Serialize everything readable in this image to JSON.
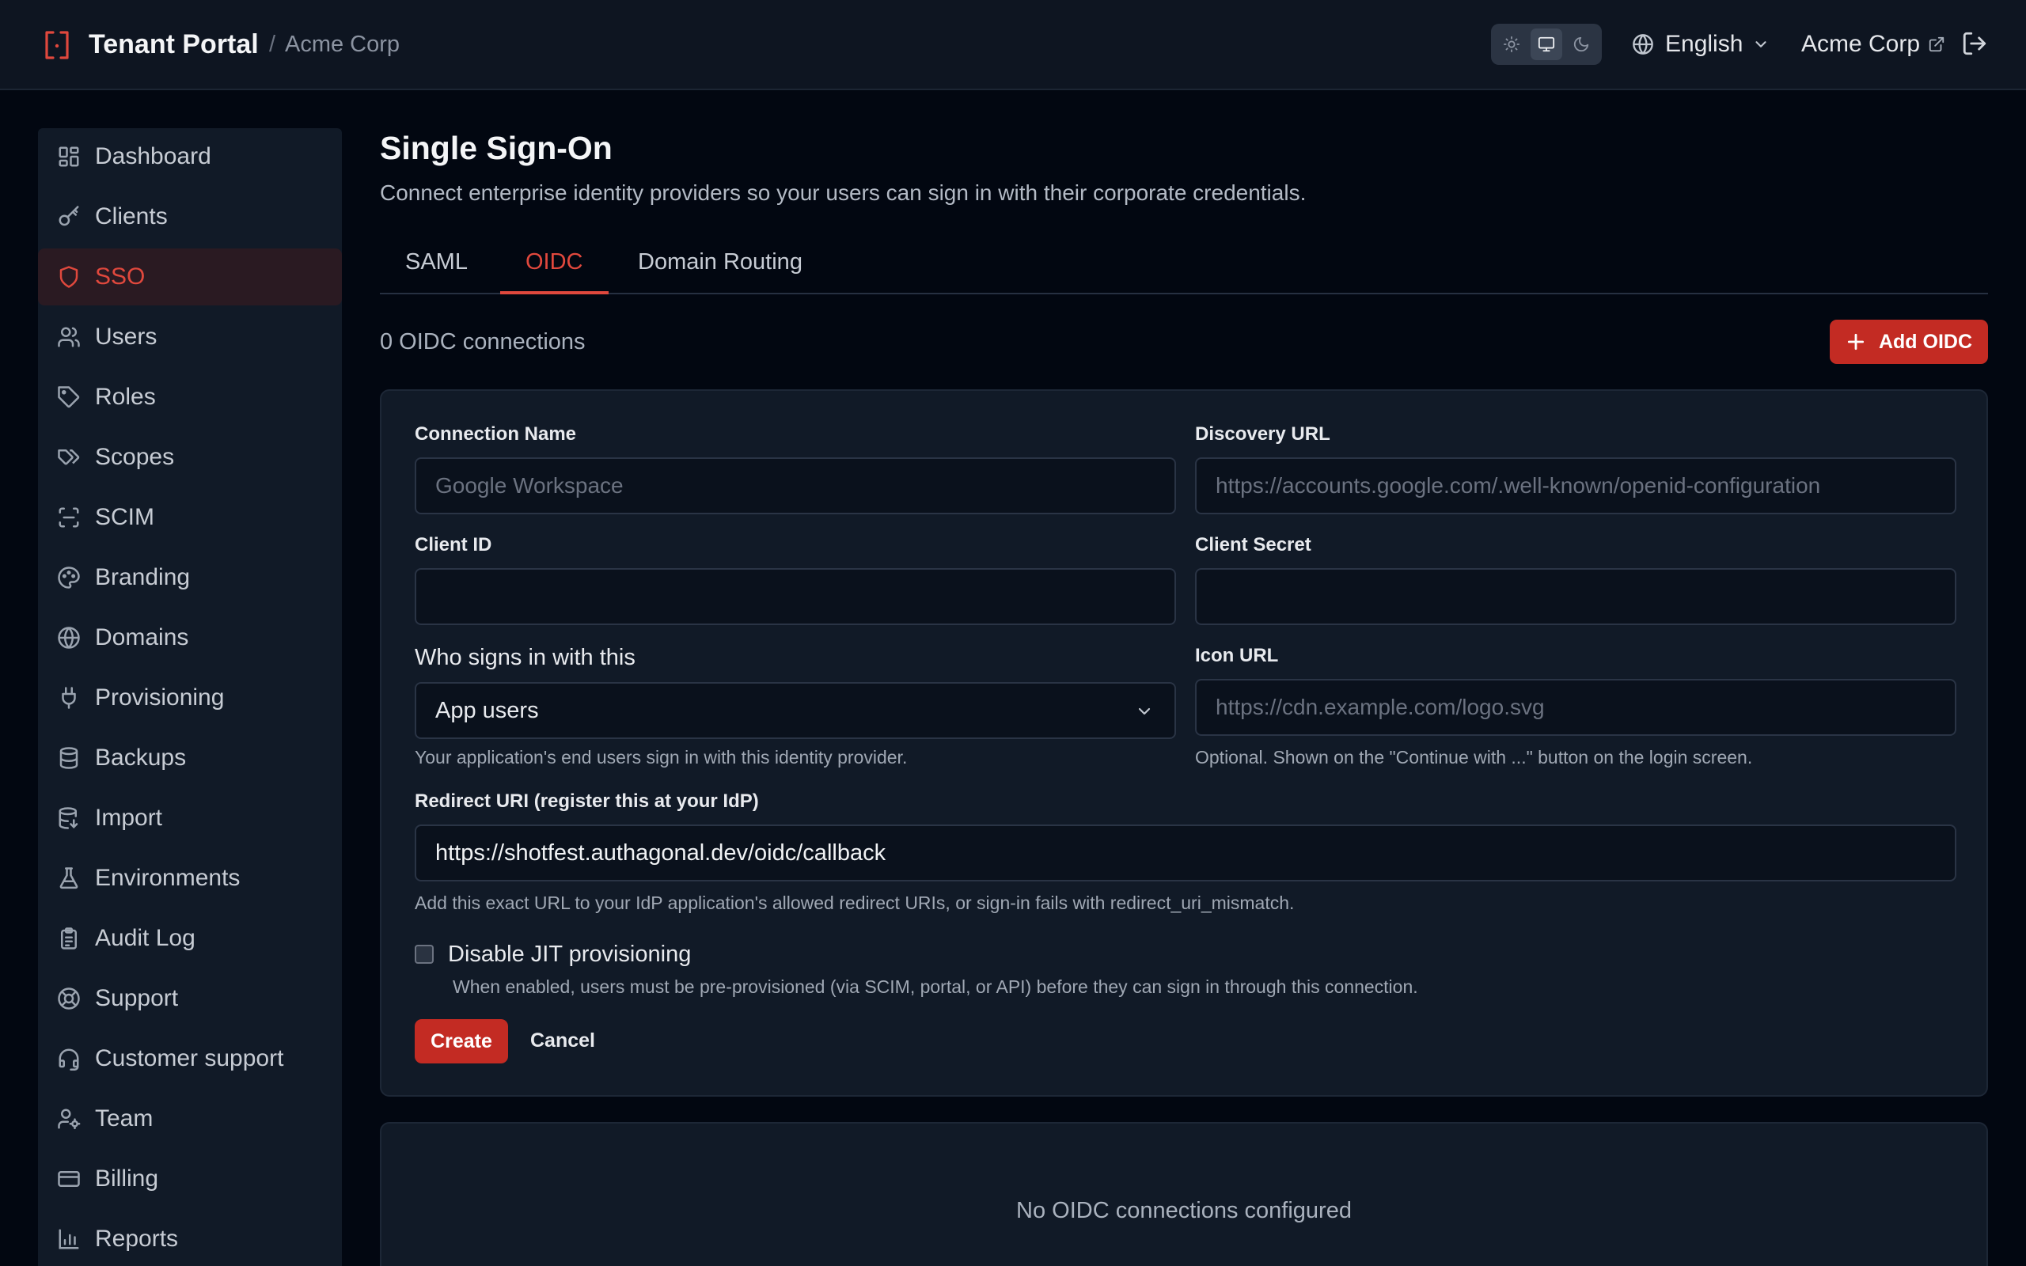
{
  "header": {
    "app_title": "Tenant Portal",
    "separator": "/",
    "tenant_breadcrumb": "Acme Corp",
    "theme_options": [
      "light-icon",
      "system-icon",
      "dark-icon"
    ],
    "theme_selected": "system",
    "language": "English",
    "tenant_link": "Acme Corp"
  },
  "sidebar": {
    "items": [
      {
        "label": "Dashboard",
        "icon": "dashboard-icon"
      },
      {
        "label": "Clients",
        "icon": "key-icon"
      },
      {
        "label": "SSO",
        "icon": "shield-icon",
        "active": true
      },
      {
        "label": "Users",
        "icon": "users-icon"
      },
      {
        "label": "Roles",
        "icon": "tag-icon"
      },
      {
        "label": "Scopes",
        "icon": "tags-icon"
      },
      {
        "label": "SCIM",
        "icon": "scan-icon"
      },
      {
        "label": "Branding",
        "icon": "palette-icon"
      },
      {
        "label": "Domains",
        "icon": "globe-icon"
      },
      {
        "label": "Provisioning",
        "icon": "plug-icon"
      },
      {
        "label": "Backups",
        "icon": "database-icon"
      },
      {
        "label": "Import",
        "icon": "database-import-icon"
      },
      {
        "label": "Environments",
        "icon": "flask-icon"
      },
      {
        "label": "Audit Log",
        "icon": "clipboard-icon"
      },
      {
        "label": "Support",
        "icon": "lifebuoy-icon"
      },
      {
        "label": "Customer support",
        "icon": "headset-icon"
      },
      {
        "label": "Team",
        "icon": "user-cog-icon"
      },
      {
        "label": "Billing",
        "icon": "credit-card-icon"
      },
      {
        "label": "Reports",
        "icon": "bar-chart-icon"
      }
    ]
  },
  "page": {
    "title": "Single Sign-On",
    "description": "Connect enterprise identity providers so your users can sign in with their corporate credentials.",
    "tabs": [
      {
        "label": "SAML"
      },
      {
        "label": "OIDC",
        "active": true
      },
      {
        "label": "Domain Routing"
      }
    ],
    "connection_count": "0 OIDC connections",
    "add_button": "Add OIDC"
  },
  "form": {
    "connection_name": {
      "label": "Connection Name",
      "placeholder": "Google Workspace",
      "value": ""
    },
    "discovery_url": {
      "label": "Discovery URL",
      "placeholder": "https://accounts.google.com/.well-known/openid-configuration",
      "value": ""
    },
    "client_id": {
      "label": "Client ID",
      "value": ""
    },
    "client_secret": {
      "label": "Client Secret",
      "value": ""
    },
    "audience": {
      "label": "Who signs in with this",
      "value": "App users",
      "help": "Your application's end users sign in with this identity provider."
    },
    "icon_url": {
      "label": "Icon URL",
      "placeholder": "https://cdn.example.com/logo.svg",
      "value": "",
      "help": "Optional. Shown on the \"Continue with ...\" button on the login screen."
    },
    "redirect_uri": {
      "label": "Redirect URI (register this at your IdP)",
      "value": "https://shotfest.authagonal.dev/oidc/callback",
      "help": "Add this exact URL to your IdP application's allowed redirect URIs, or sign-in fails with redirect_uri_mismatch."
    },
    "jit": {
      "label": "Disable JIT provisioning",
      "checked": false,
      "help": "When enabled, users must be pre-provisioned (via SCIM, portal, or API) before they can sign in through this connection."
    },
    "create_button": "Create",
    "cancel_button": "Cancel"
  },
  "empty_state": {
    "text": "No OIDC connections configured"
  },
  "colors": {
    "accent": "#e0483d",
    "button_red": "#c32b23",
    "background": "#020711",
    "panel": "#111a27"
  }
}
